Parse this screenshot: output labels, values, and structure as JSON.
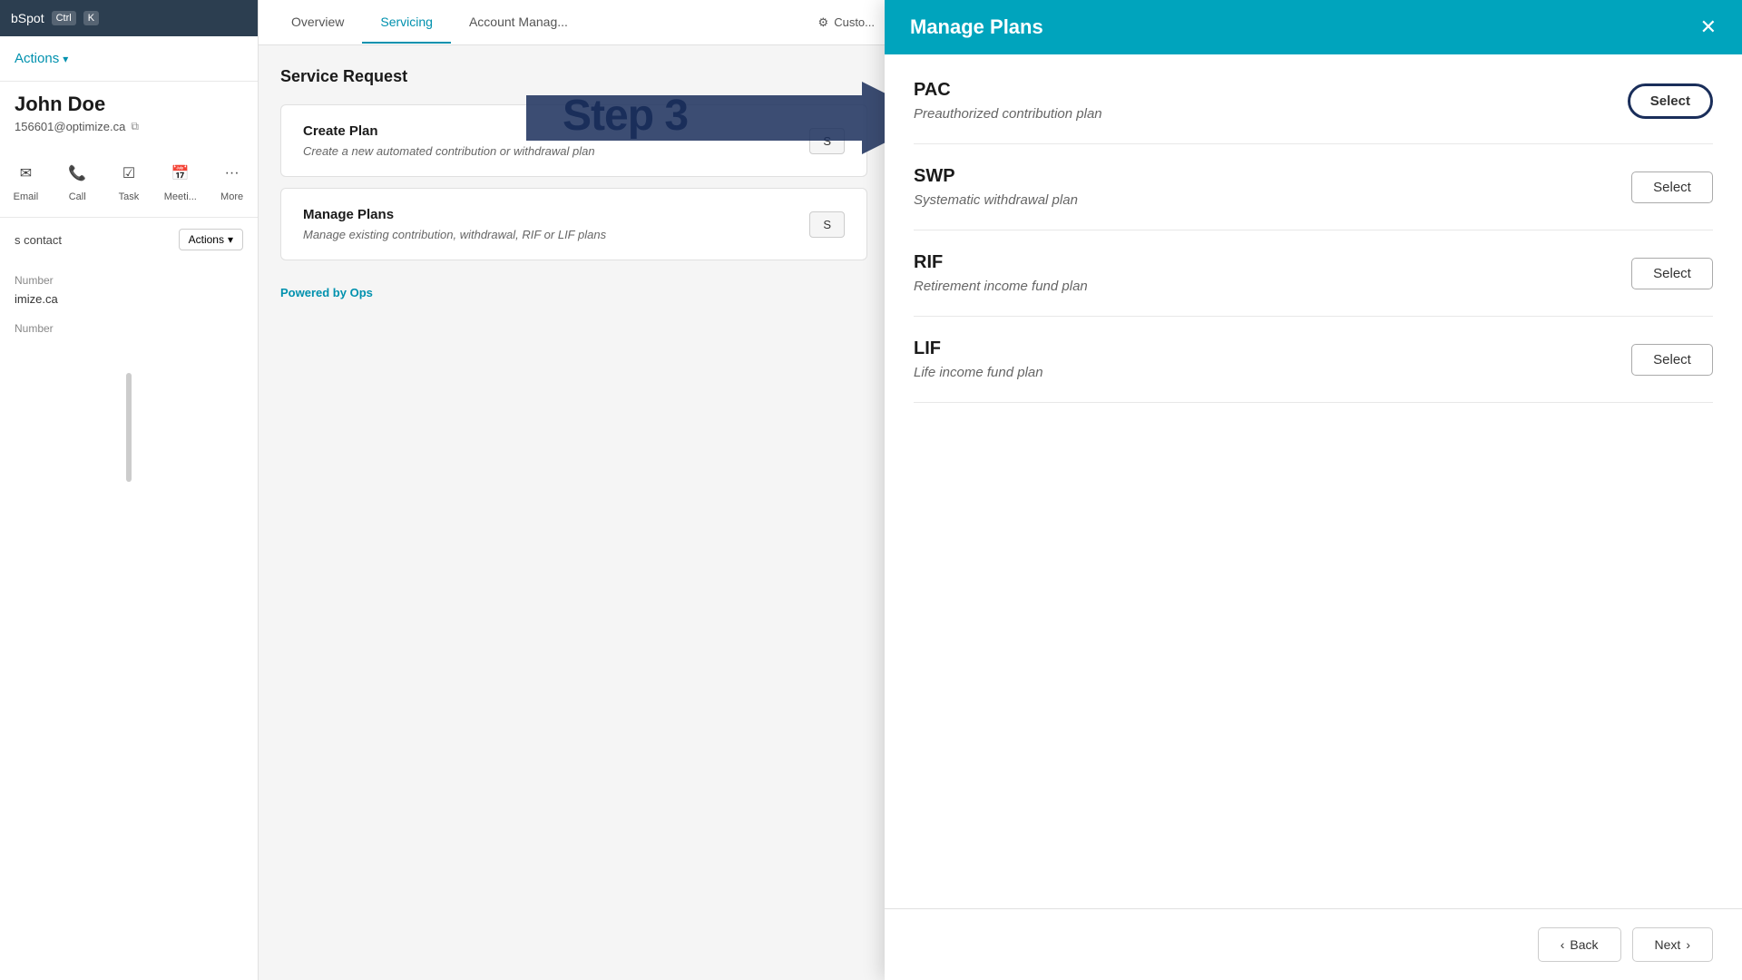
{
  "titlebar": {
    "app": "bSpot",
    "kbd1": "Ctrl",
    "kbd2": "K"
  },
  "sidebar": {
    "actions_label": "Actions",
    "contact_name": "John Doe",
    "contact_email": "156601@optimize.ca",
    "action_icons": [
      {
        "id": "email",
        "label": "Email",
        "icon": "✉"
      },
      {
        "id": "call",
        "label": "Call",
        "icon": "📞"
      },
      {
        "id": "task",
        "label": "Task",
        "icon": "☑"
      },
      {
        "id": "meeting",
        "label": "Meeti...",
        "icon": "📅"
      },
      {
        "id": "more",
        "label": "More",
        "icon": "···"
      }
    ],
    "contact_section_title": "s contact",
    "actions_small_label": "Actions",
    "number_label": "Number",
    "website": "imize.ca",
    "phone_number_label": "Number"
  },
  "tabs": [
    {
      "id": "overview",
      "label": "Overview",
      "active": false
    },
    {
      "id": "servicing",
      "label": "Servicing",
      "active": true
    },
    {
      "id": "account_manager",
      "label": "Account Manag...",
      "active": false
    }
  ],
  "customize_label": "Custo...",
  "main": {
    "section_title": "Service Request",
    "cards": [
      {
        "id": "create_plan",
        "title": "Create Plan",
        "description": "Create a new automated contribution or withdrawal plan",
        "btn_label": "S"
      },
      {
        "id": "manage_plans",
        "title": "Manage Plans",
        "description": "Manage existing contribution, withdrawal, RIF or LIF plans",
        "btn_label": "S"
      }
    ],
    "powered_by_text": "Powered by ",
    "powered_by_brand": "Ops"
  },
  "step_overlay": {
    "text": "Step 3"
  },
  "panel": {
    "title": "Manage Plans",
    "close_icon": "✕",
    "plans": [
      {
        "id": "pac",
        "name": "PAC",
        "description": "Preauthorized contribution plan",
        "btn_label": "Select",
        "highlighted": true
      },
      {
        "id": "swp",
        "name": "SWP",
        "description": "Systematic withdrawal plan",
        "btn_label": "Select",
        "highlighted": false
      },
      {
        "id": "rif",
        "name": "RIF",
        "description": "Retirement income fund plan",
        "btn_label": "Select",
        "highlighted": false
      },
      {
        "id": "lif",
        "name": "LIF",
        "description": "Life income fund plan",
        "btn_label": "Select",
        "highlighted": false
      }
    ],
    "back_label": "< Back",
    "next_label": "Next >"
  },
  "colors": {
    "teal": "#00a4bd",
    "dark_blue": "#1a2e5a",
    "link": "#0091ae"
  }
}
